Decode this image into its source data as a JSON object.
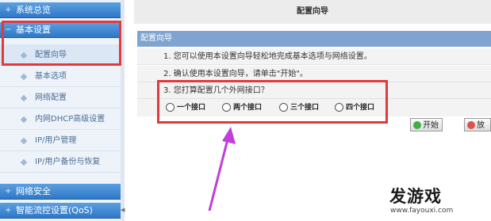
{
  "sidebar": {
    "headers": [
      {
        "label": "系统总览"
      },
      {
        "label": "基本设置"
      },
      {
        "label": "网络安全"
      },
      {
        "label": "智能流控设置(QoS)"
      }
    ],
    "items": [
      {
        "label": "配置向导"
      },
      {
        "label": "基本选项"
      },
      {
        "label": "网络配置"
      },
      {
        "label": "内网DHCP高级设置"
      },
      {
        "label": "IP/用户管理"
      },
      {
        "label": "IP/用户备份与恢复"
      }
    ]
  },
  "main": {
    "title": "配置向导",
    "panel_header": "配置向导",
    "lines": [
      "1. 您可以使用本设置向导轻松地完成基本选项与网络设置。",
      "2. 确认使用本设置向导，请单击\"开始\"。",
      "3. 您打算配置几个外网接口？"
    ],
    "options": [
      "一个接口",
      "两个接口",
      "三个接口",
      "四个接口"
    ],
    "buttons": {
      "start": "开始",
      "abandon": "放弃"
    }
  },
  "watermark": {
    "title": "发游戏",
    "url": "www.fayouxi.com"
  },
  "colors": {
    "annotation_red": "#e23a3a",
    "arrow_purple": "#c13ed8",
    "sidebar_header_blue": "#2f78c8",
    "panel_header_blue": "#7fa4cf"
  }
}
